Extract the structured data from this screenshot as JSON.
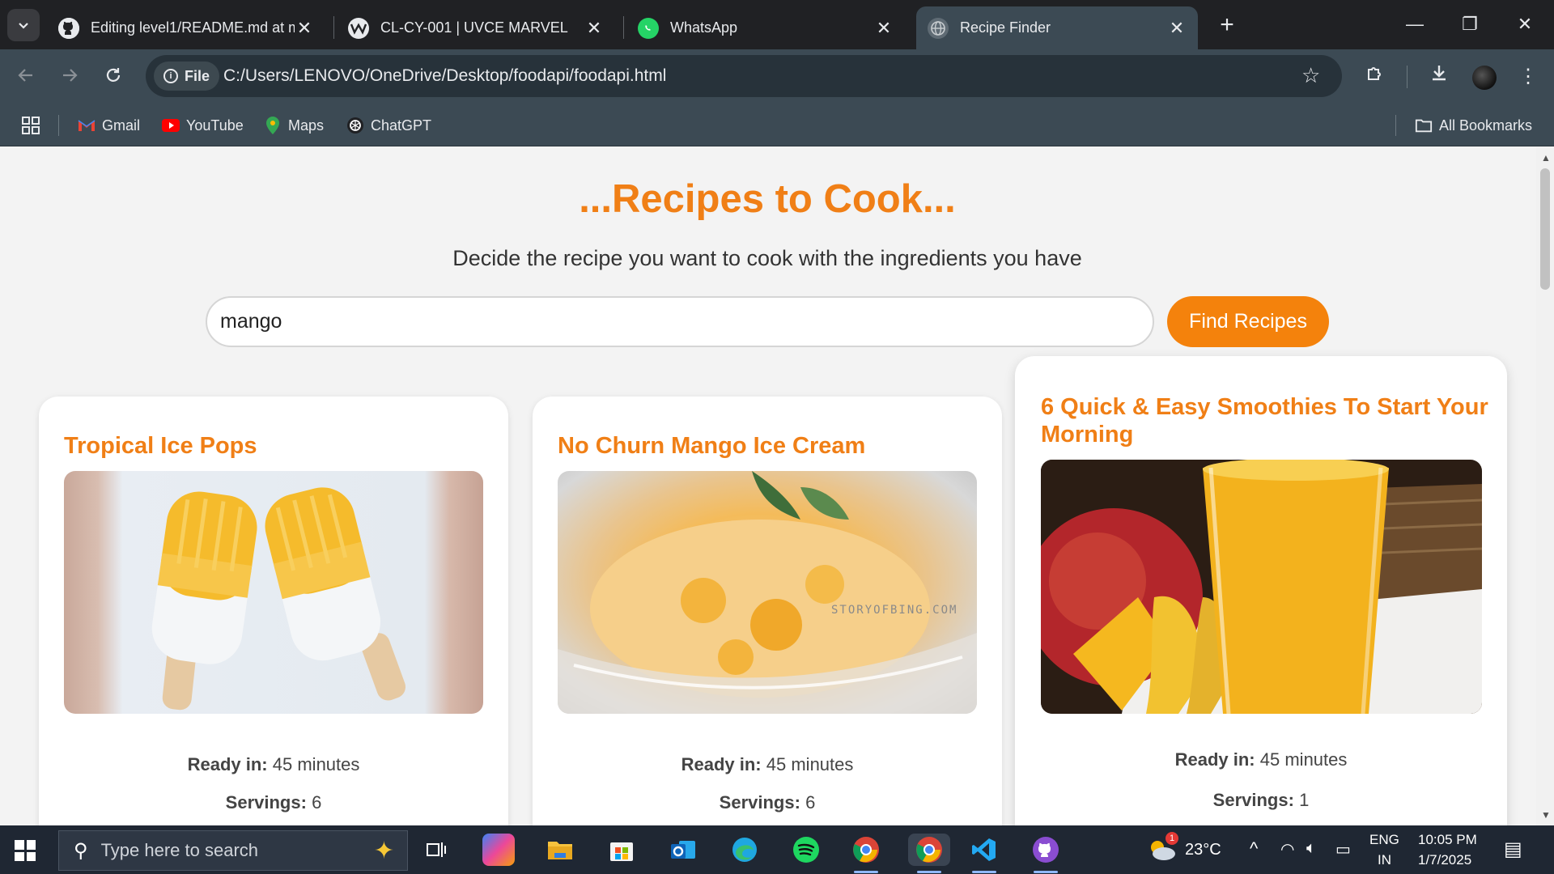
{
  "browser": {
    "tabs": [
      {
        "title": "Editing level1/README.md at m",
        "icon": "github-icon",
        "active": false
      },
      {
        "title": "CL-CY-001 | UVCE MARVEL",
        "icon": "marvel-icon",
        "active": false
      },
      {
        "title": "WhatsApp",
        "icon": "whatsapp-icon",
        "active": false
      },
      {
        "title": "Recipe Finder",
        "icon": "globe-icon",
        "active": true
      }
    ],
    "address": {
      "chip_label": "File",
      "url": "C:/Users/LENOVO/OneDrive/Desktop/foodapi/foodapi.html"
    },
    "bookmarks": [
      {
        "label": "Gmail",
        "icon": "gmail-icon"
      },
      {
        "label": "YouTube",
        "icon": "youtube-icon"
      },
      {
        "label": "Maps",
        "icon": "maps-icon"
      },
      {
        "label": "ChatGPT",
        "icon": "chatgpt-icon"
      }
    ],
    "all_bookmarks_label": "All Bookmarks"
  },
  "page": {
    "heading": "...Recipes to Cook...",
    "subtitle": "Decide the recipe you want to cook with the ingredients you have",
    "search_value": "mango",
    "find_button": "Find Recipes",
    "ready_label": "Ready in:",
    "servings_label": "Servings:",
    "recipes": [
      {
        "title": "Tropical Ice Pops",
        "ready": "45 minutes",
        "servings": "6"
      },
      {
        "title": "No Churn Mango Ice Cream",
        "ready": "45 minutes",
        "servings": "6",
        "watermark": "STORYOFBING.COM"
      },
      {
        "title": "6 Quick & Easy Smoothies To Start Your Morning",
        "ready": "45 minutes",
        "servings": "1"
      }
    ]
  },
  "taskbar": {
    "search_placeholder": "Type here to search",
    "weather": "23°C",
    "weather_badge": "1",
    "language": "ENG",
    "region": "IN",
    "time": "10:05 PM",
    "date": "1/7/2025"
  },
  "colors": {
    "accent": "#f07f16",
    "button": "#f4820c",
    "chrome_dark": "#202124",
    "chrome_toolbar": "#3c4a54"
  }
}
